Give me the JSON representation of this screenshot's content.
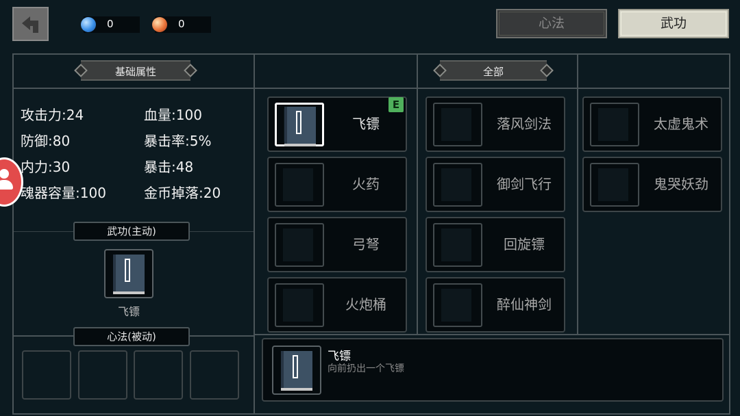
{
  "header": {
    "back_icon": "back-arrow-icon",
    "currencies": [
      {
        "icon": "blue-gem-icon",
        "color": "#3a8fe8",
        "value": "0"
      },
      {
        "icon": "red-gem-icon",
        "color": "#e8743a",
        "value": "0"
      }
    ],
    "tabs": [
      {
        "label": "心法",
        "active": false
      },
      {
        "label": "武功",
        "active": true
      }
    ]
  },
  "stats_panel": {
    "title": "基础属性",
    "stats": [
      {
        "label": "攻击力",
        "value": "24"
      },
      {
        "label": "血量",
        "value": "100"
      },
      {
        "label": "防御",
        "value": "80"
      },
      {
        "label": "暴击率",
        "value": "5%"
      },
      {
        "label": "内力",
        "value": "30"
      },
      {
        "label": "暴击",
        "value": "48"
      },
      {
        "label": "魂器容量",
        "value": "100"
      },
      {
        "label": "金币掉落",
        "value": "20"
      }
    ],
    "active_label": "武功(主动)",
    "equipped_name": "飞镖",
    "passive_label": "心法(被动)"
  },
  "filter": {
    "label": "全部"
  },
  "skills": [
    {
      "name": "飞镖",
      "active": true,
      "badge": "E"
    },
    {
      "name": "火药"
    },
    {
      "name": "弓弩"
    },
    {
      "name": "火炮桶"
    },
    {
      "name": "落风剑法"
    },
    {
      "name": "御剑飞行"
    },
    {
      "name": "回旋镖"
    },
    {
      "name": "醉仙神剑"
    },
    {
      "name": "太虚鬼术"
    },
    {
      "name": "鬼哭妖劲"
    }
  ],
  "detail": {
    "name": "飞镖",
    "description": "向前扔出一个飞镖"
  }
}
